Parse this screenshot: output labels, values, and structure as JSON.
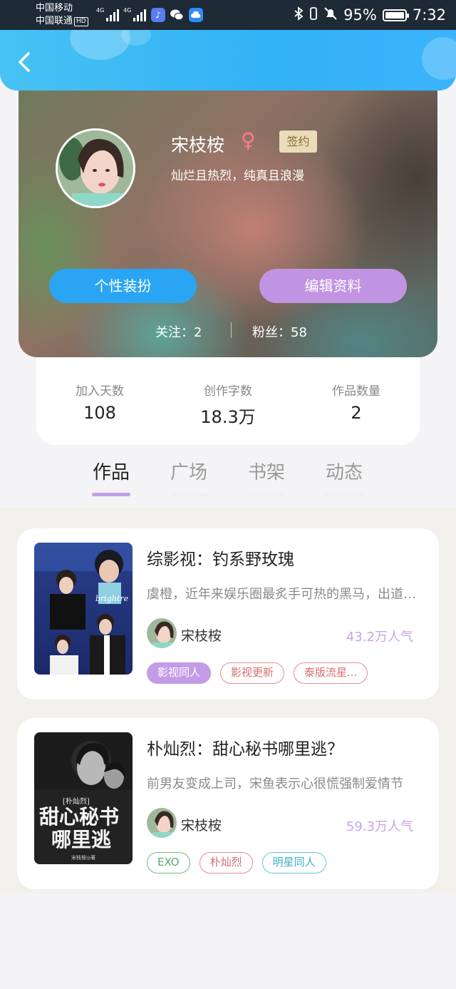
{
  "status_bar": {
    "carrier1": "中国移动",
    "carrier2": "中国联通",
    "hd_badge": "HD",
    "net1": "4G",
    "net2": "4G",
    "battery_percent": "95%",
    "time": "7:32"
  },
  "profile": {
    "nickname": "宋枝桉",
    "gender_symbol": "♀",
    "signed_badge": "签约",
    "motto": "灿烂且热烈，纯真且浪漫",
    "dress_button": "个性装扮",
    "edit_button": "编辑资料",
    "following_label": "关注：",
    "following_count": "2",
    "fans_label": "粉丝：",
    "fans_count": "58"
  },
  "stats": [
    {
      "label": "加入天数",
      "value": "108"
    },
    {
      "label": "创作字数",
      "value": "18.3万"
    },
    {
      "label": "作品数量",
      "value": "2"
    }
  ],
  "tabs": [
    {
      "label": "作品",
      "active": true
    },
    {
      "label": "广场",
      "active": false
    },
    {
      "label": "书架",
      "active": false
    },
    {
      "label": "动态",
      "active": false
    }
  ],
  "books": [
    {
      "title": "综影视：钓系野玫瑰",
      "description": "虞橙，近年来娱乐圈最炙手可热的黑马，出道即巅峰",
      "author": "宋枝桉",
      "popularity": "43.2万人气",
      "cover_text": "brightre",
      "tags": [
        "影视同人",
        "影视更新",
        "泰版流星..."
      ]
    },
    {
      "title": "朴灿烈：甜心秘书哪里逃？",
      "description": "前男友变成上司，宋鱼表示心很慌强制爱情节",
      "author": "宋枝桉",
      "popularity": "59.3万人气",
      "cover_subtitle": "[朴灿烈]",
      "cover_title_line1": "甜心秘书",
      "cover_title_line2": "哪里逃",
      "cover_author": "宋枝桉◎著",
      "tags": [
        "EXO",
        "朴灿烈",
        "明星同人"
      ]
    }
  ],
  "colors": {
    "header_blue": "#32b2f7",
    "dress_button": "#2aa5f3",
    "edit_button": "#c194e3",
    "popularity": "#c7a4e4",
    "tab_underline": "#c3a0e8"
  }
}
